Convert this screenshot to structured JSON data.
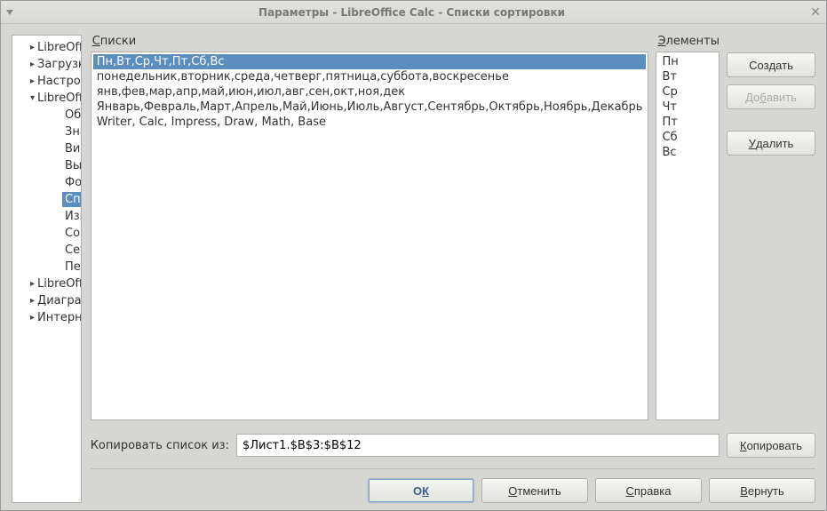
{
  "window": {
    "title": "Параметры - LibreOffice Calc - Списки сортировки"
  },
  "tree": {
    "items": [
      {
        "label": "LibreOffice",
        "expanded": false,
        "level": 1,
        "hasChildren": true
      },
      {
        "label": "Загрузка/сохранение",
        "expanded": false,
        "level": 1,
        "hasChildren": true
      },
      {
        "label": "Настройки языка",
        "expanded": false,
        "level": 1,
        "hasChildren": true
      },
      {
        "label": "LibreOffice Calc",
        "expanded": true,
        "level": 1,
        "hasChildren": true
      },
      {
        "label": "Общие",
        "level": 2
      },
      {
        "label": "Значения по умолчанию",
        "level": 2
      },
      {
        "label": "Вид",
        "level": 2
      },
      {
        "label": "Вычисления",
        "level": 2
      },
      {
        "label": "Формула",
        "level": 2
      },
      {
        "label": "Списки сортировки",
        "level": 2,
        "selected": true
      },
      {
        "label": "Изменения",
        "level": 2
      },
      {
        "label": "Совместимость",
        "level": 2
      },
      {
        "label": "Сетка",
        "level": 2
      },
      {
        "label": "Печать",
        "level": 2
      },
      {
        "label": "LibreOffice Base",
        "expanded": false,
        "level": 1,
        "hasChildren": true
      },
      {
        "label": "Диаграммы",
        "expanded": false,
        "level": 1,
        "hasChildren": true
      },
      {
        "label": "Интернет",
        "expanded": false,
        "level": 1,
        "hasChildren": true
      }
    ]
  },
  "labels": {
    "lists": "Списки",
    "lists_mn": "С",
    "elements": "Элементы",
    "elements_mn": "Э"
  },
  "lists": {
    "items": [
      {
        "text": "Пн,Вт,Ср,Чт,Пт,Сб,Вс",
        "selected": true
      },
      {
        "text": "понедельник,вторник,среда,четверг,пятница,суббота,воскресенье"
      },
      {
        "text": "янв,фев,мар,апр,май,июн,июл,авг,сен,окт,ноя,дек"
      },
      {
        "text": "Январь,Февраль,Март,Апрель,Май,Июнь,Июль,Август,Сентябрь,Октябрь,Ноябрь,Декабрь"
      },
      {
        "text": "Writer, Calc, Impress, Draw, Math, Base"
      }
    ]
  },
  "elements": {
    "items": [
      "Пн",
      "Вт",
      "Ср",
      "Чт",
      "Пт",
      "Сб",
      "Вс"
    ]
  },
  "buttons": {
    "create": "Соз",
    "create_mn": "д",
    "create_suf": "ать",
    "add": "До",
    "add_mn": "б",
    "add_suf": "авить",
    "delete": "Удалить",
    "delete_mn": "У",
    "delete_suf": "далить",
    "copy": "Копировать",
    "copy_mn": "К",
    "copy_suf": "опировать",
    "ok": "О",
    "ok_mn": "К",
    "cancel": "Отменить",
    "cancel_mn": "О",
    "cancel_suf": "тменить",
    "help": "Справка",
    "help_mn": "С",
    "help_suf": "правка",
    "revert": "Вернуть",
    "revert_mn": "В",
    "revert_suf": "ернуть"
  },
  "copyRow": {
    "label": "Копировать список ",
    "label_mn": "и",
    "label_suf": "з:",
    "value": "$Лист1.$B$3:$B$12"
  }
}
